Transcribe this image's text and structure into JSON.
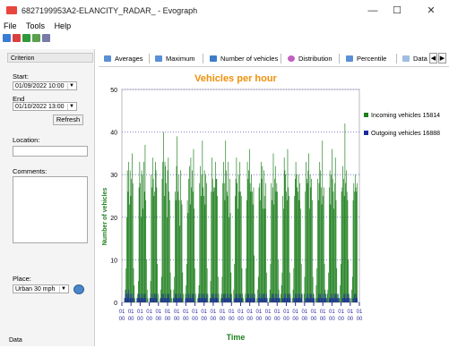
{
  "window": {
    "title": "6827199953A2-ELANCITY_RADAR_ - Evograph",
    "minimize": "—",
    "maximize": "☐",
    "close": "✕"
  },
  "menu": [
    "File",
    "Tools",
    "Help"
  ],
  "toolbar": [
    "open-icon",
    "export-pdf-icon",
    "export-excel-icon",
    "settings-icon",
    "print-icon"
  ],
  "left_panel": {
    "header": "Criterion",
    "start_label": "Start:",
    "start_value": "01/09/2022 10:00",
    "end_label": "End",
    "end_value": "01/10/2022 13:00",
    "refresh_label": "Refresh",
    "location_label": "Location:",
    "location_value": "",
    "comments_label": "Comments:",
    "comments_value": "",
    "place_label": "Place:",
    "place_value": "Urban 30 mph",
    "bottom_label": "Data"
  },
  "tabs": [
    {
      "label": "Averages",
      "icon": "averages-icon"
    },
    {
      "label": "Maximum",
      "icon": "maximum-icon"
    },
    {
      "label": "Number of vehicles",
      "icon": "vehicles-icon",
      "active": true
    },
    {
      "label": "Distribution",
      "icon": "distribution-icon"
    },
    {
      "label": "Percentile",
      "icon": "percentile-icon"
    },
    {
      "label": "Data",
      "icon": "data-icon"
    }
  ],
  "colors": {
    "incoming": "#1e7f1e",
    "outgoing": "#1a2a9a",
    "title": "#f0900a",
    "gridline": "#8080c8"
  },
  "chart_data": {
    "type": "bar",
    "title": "Vehicles per hour",
    "xlabel": "Time",
    "ylabel": "Number of vehicles",
    "ylim": [
      0,
      50
    ],
    "yticks": [
      0,
      10,
      20,
      30,
      40,
      50
    ],
    "x_tick_text_top": "01",
    "x_tick_text_bottom": "00",
    "legend_position": "right",
    "series": [
      {
        "name": "Incoming vehicles 15814",
        "values": [
          0,
          1,
          3,
          8,
          20,
          31,
          26,
          33,
          23,
          31,
          25,
          29,
          35,
          28,
          8,
          4,
          1,
          0,
          0,
          1,
          2,
          5,
          27,
          33,
          28,
          20,
          31,
          30,
          22,
          33,
          26,
          37,
          24,
          10,
          3,
          1,
          0,
          0,
          1,
          5,
          30,
          27,
          34,
          29,
          25,
          26,
          33,
          31,
          27,
          9,
          2,
          0,
          0,
          1,
          3,
          6,
          29,
          33,
          40,
          25,
          33,
          32,
          28,
          20,
          31,
          34,
          26,
          24,
          7,
          3,
          1,
          0,
          1,
          3,
          6,
          26,
          24,
          32,
          39,
          26,
          30,
          24,
          18,
          31,
          24,
          23,
          7,
          2,
          0,
          0,
          2,
          4,
          9,
          24,
          21,
          29,
          32,
          23,
          34,
          27,
          31,
          26,
          36,
          22,
          8,
          2,
          0,
          0,
          1,
          2,
          4,
          28,
          32,
          25,
          30,
          38,
          27,
          25,
          31,
          23,
          30,
          28,
          8,
          2,
          0,
          0,
          1,
          5,
          26,
          34,
          29,
          26,
          27,
          27,
          33,
          29,
          29,
          25,
          6,
          2,
          0,
          0,
          1,
          2,
          6,
          28,
          33,
          28,
          24,
          38,
          31,
          26,
          25,
          33,
          20,
          29,
          21,
          7,
          2,
          0,
          0,
          3,
          9,
          25,
          29,
          34,
          28,
          22,
          30,
          26,
          33,
          26,
          25,
          8,
          2,
          1,
          0,
          0,
          2,
          8,
          24,
          33,
          29,
          31,
          36,
          28,
          26,
          30,
          26,
          23,
          27,
          11,
          2,
          0,
          0,
          1,
          3,
          6,
          27,
          28,
          24,
          33,
          29,
          32,
          22,
          31,
          25,
          22,
          28,
          7,
          1,
          0,
          0,
          1,
          3,
          9,
          28,
          24,
          27,
          35,
          23,
          29,
          32,
          26,
          28,
          26,
          10,
          3,
          0,
          1,
          2,
          4,
          7,
          25,
          22,
          34,
          31,
          30,
          26,
          24,
          36,
          27,
          25,
          7,
          2,
          0,
          0,
          1,
          3,
          8,
          25,
          29,
          33,
          30,
          27,
          26,
          30,
          24,
          28,
          22,
          9,
          2,
          0,
          0,
          2,
          6,
          26,
          33,
          29,
          28,
          31,
          35,
          22,
          30,
          27,
          29,
          24,
          6,
          2,
          0,
          0,
          1,
          4,
          8,
          29,
          24,
          28,
          33,
          31,
          27,
          23,
          38,
          25,
          27,
          9,
          3,
          1,
          0,
          2,
          3,
          7,
          27,
          31,
          23,
          30,
          36,
          29,
          26,
          22,
          28,
          34,
          24,
          8,
          2,
          0,
          0,
          1,
          4,
          9,
          26,
          27,
          32,
          29,
          25,
          42,
          28,
          31,
          26,
          24,
          10,
          2,
          0,
          0,
          1,
          3,
          6,
          24,
          28,
          26,
          30,
          27,
          26,
          28
        ]
      },
      {
        "name": "Outgoing vehicles 16888",
        "values": [
          0,
          1,
          2,
          3,
          2,
          1,
          2,
          3,
          1,
          2,
          1,
          2,
          1,
          2,
          1,
          0,
          0,
          0,
          0,
          1,
          1,
          2,
          1,
          2,
          1,
          1,
          2,
          1,
          1,
          2,
          1,
          2,
          1,
          0,
          0,
          0,
          0,
          0,
          1,
          1,
          2,
          1,
          2,
          1,
          1,
          2,
          1,
          2,
          1,
          0,
          0,
          0,
          0,
          0,
          1,
          1,
          2,
          1,
          2,
          1,
          1,
          2,
          1,
          1,
          2,
          1,
          2,
          1,
          0,
          0,
          0,
          0,
          0,
          1,
          1,
          2,
          1,
          2,
          1,
          1,
          2,
          1,
          1,
          2,
          1,
          1,
          0,
          0,
          0,
          0,
          1,
          1,
          2,
          1,
          1,
          2,
          1,
          2,
          1,
          1,
          2,
          1,
          2,
          1,
          0,
          0,
          0,
          0,
          0,
          1,
          1,
          2,
          1,
          2,
          1,
          1,
          2,
          1,
          2,
          1,
          1,
          2,
          1,
          0,
          0,
          0,
          0,
          1,
          1,
          2,
          1,
          2,
          1,
          1,
          2,
          1,
          2,
          1,
          1,
          0,
          0,
          0,
          0,
          0,
          1,
          1,
          2,
          1,
          2,
          1,
          1,
          2,
          1,
          2,
          1,
          1,
          2,
          1,
          0,
          0,
          0,
          0,
          1,
          1,
          2,
          1,
          2,
          1,
          1,
          2,
          1,
          2,
          1,
          1,
          0,
          0,
          0,
          0,
          0,
          1,
          1,
          2,
          1,
          2,
          1,
          1,
          2,
          1,
          2,
          1,
          1,
          2,
          1,
          0,
          0,
          0,
          0,
          1,
          1,
          2,
          1,
          2,
          1,
          1,
          2,
          1,
          2,
          1,
          1,
          2,
          1,
          0,
          0,
          0,
          0,
          1,
          1,
          2,
          1,
          2,
          1,
          1,
          2,
          1,
          2,
          1,
          1,
          2,
          1,
          0,
          0,
          0,
          1,
          1,
          1,
          2,
          1,
          2,
          1,
          1,
          2,
          1,
          2,
          1,
          1,
          0,
          0,
          0,
          0,
          1,
          1,
          2,
          1,
          2,
          1,
          1,
          2,
          1,
          2,
          1,
          1,
          2,
          0,
          0,
          0,
          0,
          1,
          1,
          2,
          1,
          2,
          1,
          1,
          2,
          1,
          2,
          1,
          1,
          2,
          1,
          0,
          0,
          0,
          0,
          1,
          1,
          2,
          1,
          2,
          1,
          1,
          2,
          1,
          2,
          1,
          1,
          2,
          1,
          0,
          0,
          0,
          1,
          1,
          1,
          2,
          1,
          2,
          1,
          1,
          2,
          1,
          2,
          1,
          1,
          2,
          1,
          0,
          0,
          0,
          0,
          1,
          1,
          2,
          1,
          2,
          1,
          1,
          2,
          1,
          2,
          1,
          1,
          0,
          0,
          0,
          0,
          1,
          1,
          2,
          1,
          2,
          1,
          1,
          2,
          1,
          2,
          1
        ]
      }
    ]
  }
}
